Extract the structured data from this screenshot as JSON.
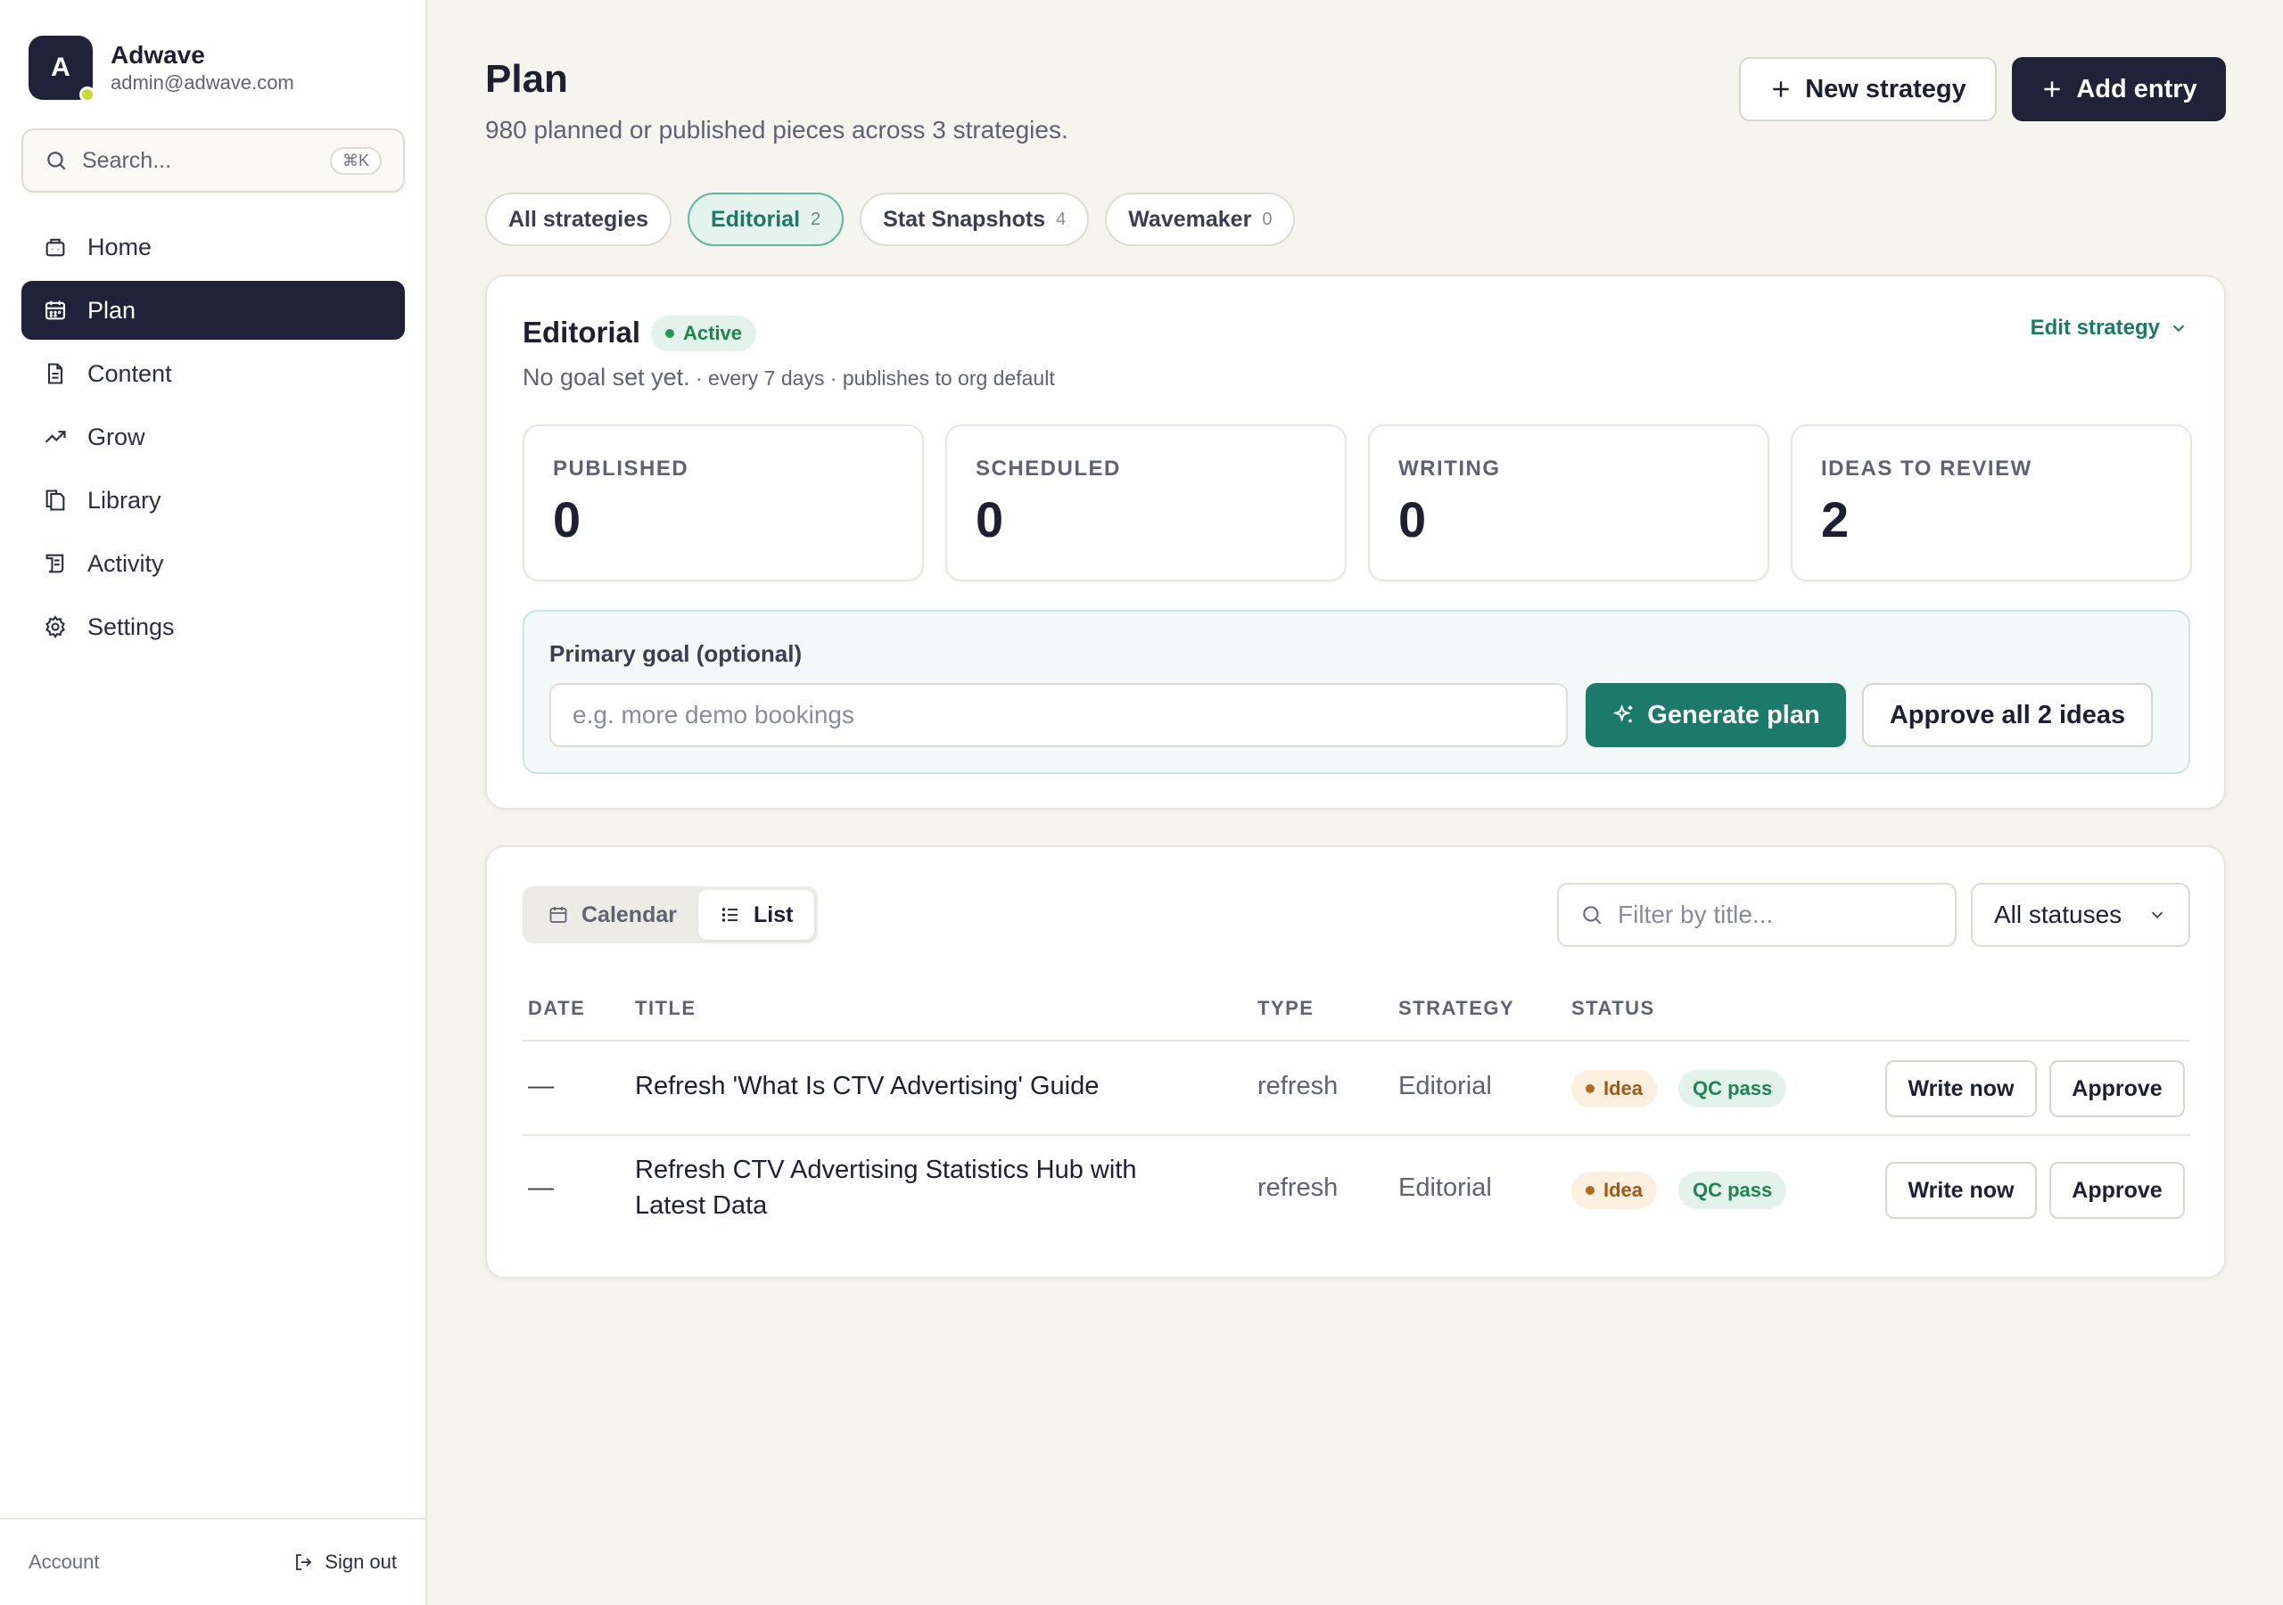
{
  "app": {
    "name": "Adwave",
    "email": "admin@adwave.com",
    "avatar_letter": "A"
  },
  "search": {
    "placeholder": "Search...",
    "shortcut": "⌘K"
  },
  "nav": {
    "items": [
      {
        "label": "Home",
        "icon": "home-icon"
      },
      {
        "label": "Plan",
        "icon": "calendar-icon",
        "active": true
      },
      {
        "label": "Content",
        "icon": "document-icon"
      },
      {
        "label": "Grow",
        "icon": "trending-up-icon"
      },
      {
        "label": "Library",
        "icon": "copy-icon"
      },
      {
        "label": "Activity",
        "icon": "scroll-icon"
      },
      {
        "label": "Settings",
        "icon": "gear-icon"
      }
    ]
  },
  "footer": {
    "account": "Account",
    "signout": "Sign out"
  },
  "header": {
    "title": "Plan",
    "subtitle": "980 planned or published pieces across 3 strategies.",
    "new_strategy": "New strategy",
    "add_entry": "Add entry"
  },
  "strategies": [
    {
      "label": "All strategies",
      "count": ""
    },
    {
      "label": "Editorial",
      "count": "2",
      "active": true
    },
    {
      "label": "Stat Snapshots",
      "count": "4"
    },
    {
      "label": "Wavemaker",
      "count": "0"
    }
  ],
  "strategy": {
    "name": "Editorial",
    "status": "Active",
    "goal_text": "No goal set yet.",
    "meta": " · every 7 days · publishes to org default",
    "edit_label": "Edit strategy",
    "stats": [
      {
        "label": "PUBLISHED",
        "value": "0"
      },
      {
        "label": "SCHEDULED",
        "value": "0"
      },
      {
        "label": "WRITING",
        "value": "0"
      },
      {
        "label": "IDEAS TO REVIEW",
        "value": "2"
      }
    ],
    "goal_label": "Primary goal (optional)",
    "goal_placeholder": "e.g. more demo bookings",
    "generate_label": "Generate plan",
    "approve_all_label": "Approve all 2 ideas"
  },
  "list": {
    "view_calendar": "Calendar",
    "view_list": "List",
    "filter_placeholder": "Filter by title...",
    "status_filter": "All statuses",
    "columns": [
      "DATE",
      "TITLE",
      "TYPE",
      "STRATEGY",
      "STATUS"
    ],
    "rows": [
      {
        "date": "—",
        "title": "Refresh 'What Is CTV Advertising' Guide",
        "type": "refresh",
        "strategy": "Editorial",
        "status": "Idea",
        "qc": "QC pass",
        "write": "Write now",
        "approve": "Approve"
      },
      {
        "date": "—",
        "title": "Refresh CTV Advertising Statistics Hub with Latest Data",
        "type": "refresh",
        "strategy": "Editorial",
        "status": "Idea",
        "qc": "QC pass",
        "write": "Write now",
        "approve": "Approve"
      }
    ]
  },
  "colors": {
    "primary_dark": "#1f2238",
    "accent_teal": "#1c7a6b",
    "background": "#f6f4ee"
  }
}
